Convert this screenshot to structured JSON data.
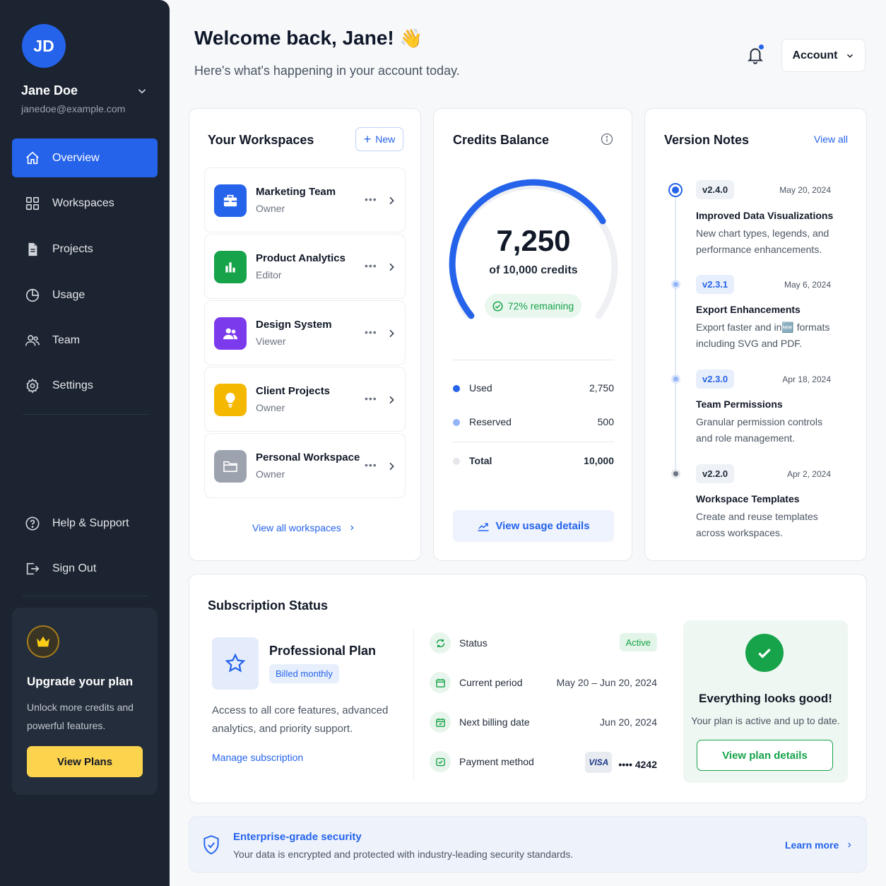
{
  "user": {
    "initials": "JD",
    "name": "Jane Doe",
    "email": "janedoe@example.com"
  },
  "nav": {
    "items": [
      {
        "label": "Overview",
        "icon": "home-icon",
        "active": true
      },
      {
        "label": "Workspaces",
        "icon": "grid-icon"
      },
      {
        "label": "Projects",
        "icon": "file-icon"
      },
      {
        "label": "Usage",
        "icon": "pie-chart-icon"
      },
      {
        "label": "Team",
        "icon": "users-icon"
      },
      {
        "label": "Settings",
        "icon": "gear-icon"
      }
    ],
    "bottom": [
      {
        "label": "Help & Support",
        "icon": "help-icon"
      },
      {
        "label": "Sign Out",
        "icon": "sign-out-icon"
      }
    ]
  },
  "upgrade": {
    "title": "Upgrade your plan",
    "text": "Unlock more credits and powerful features.",
    "button": "View Plans"
  },
  "header": {
    "title": "Welcome back, Jane!",
    "emoji": "👋",
    "subtitle": "Here's what's happening in your account today.",
    "account_label": "Account"
  },
  "workspaces": {
    "title": "Your Workspaces",
    "new_label": "New",
    "items": [
      {
        "name": "Marketing Team",
        "role": "Owner",
        "color": "#2563eb",
        "icon": "briefcase-icon"
      },
      {
        "name": "Product Analytics",
        "role": "Editor",
        "color": "#16a34a",
        "icon": "bar-chart-icon"
      },
      {
        "name": "Design System",
        "role": "Viewer",
        "color": "#7c3aed",
        "icon": "users-icon"
      },
      {
        "name": "Client Projects",
        "role": "Owner",
        "color": "#f5b800",
        "icon": "lightbulb-icon"
      },
      {
        "name": "Personal Workspace",
        "role": "Owner",
        "color": "#9ca3af",
        "icon": "folder-icon"
      }
    ],
    "view_all": "View all workspaces"
  },
  "credits": {
    "title": "Credits Balance",
    "value": "7,250",
    "of_text": "of 10,000 credits",
    "remaining": "72% remaining",
    "remaining_fraction": 0.725,
    "rows": [
      {
        "label": "Used",
        "value": "2,750",
        "color": "#2563eb"
      },
      {
        "label": "Reserved",
        "value": "500",
        "color": "#93b4f5"
      },
      {
        "label": "Total",
        "value": "10,000",
        "color": "#e5e7eb"
      }
    ],
    "usage_button": "View usage details"
  },
  "version_notes": {
    "title": "Version Notes",
    "view_all": "View all",
    "items": [
      {
        "version": "v2.4.0",
        "date": "May 20, 2024",
        "title": "Improved Data Visualizations",
        "desc": "New chart types, legends, and performance enhancements."
      },
      {
        "version": "v2.3.1",
        "date": "May 6, 2024",
        "title": "Export Enhancements",
        "desc": "Export faster and in🆕 formats including SVG and PDF."
      },
      {
        "version": "v2.3.0",
        "date": "Apr 18, 2024",
        "title": "Team Permissions",
        "desc": "Granular permission controls and role management."
      },
      {
        "version": "v2.2.0",
        "date": "Apr 2, 2024",
        "title": "Workspace Templates",
        "desc": "Create and reuse templates across workspaces."
      }
    ]
  },
  "subscription": {
    "title": "Subscription Status",
    "plan_name": "Professional Plan",
    "billing": "Billed monthly",
    "desc": "Access to all core features, advanced analytics, and priority support.",
    "manage": "Manage subscription",
    "rows": [
      {
        "label": "Status",
        "value": "Active"
      },
      {
        "label": "Current period",
        "value": "May 20 – Jun 20, 2024"
      },
      {
        "label": "Next billing date",
        "value": "Jun 20, 2024"
      },
      {
        "label": "Payment method",
        "card_brand": "VISA",
        "value": "•••• 4242"
      }
    ],
    "good_title": "Everything looks good!",
    "good_text": "Your plan is active and up to date.",
    "plan_details_button": "View plan details"
  },
  "security": {
    "title": "Enterprise-grade security",
    "text": "Your data is encrypted and protected with industry-leading security standards.",
    "learn_more": "Learn more"
  }
}
